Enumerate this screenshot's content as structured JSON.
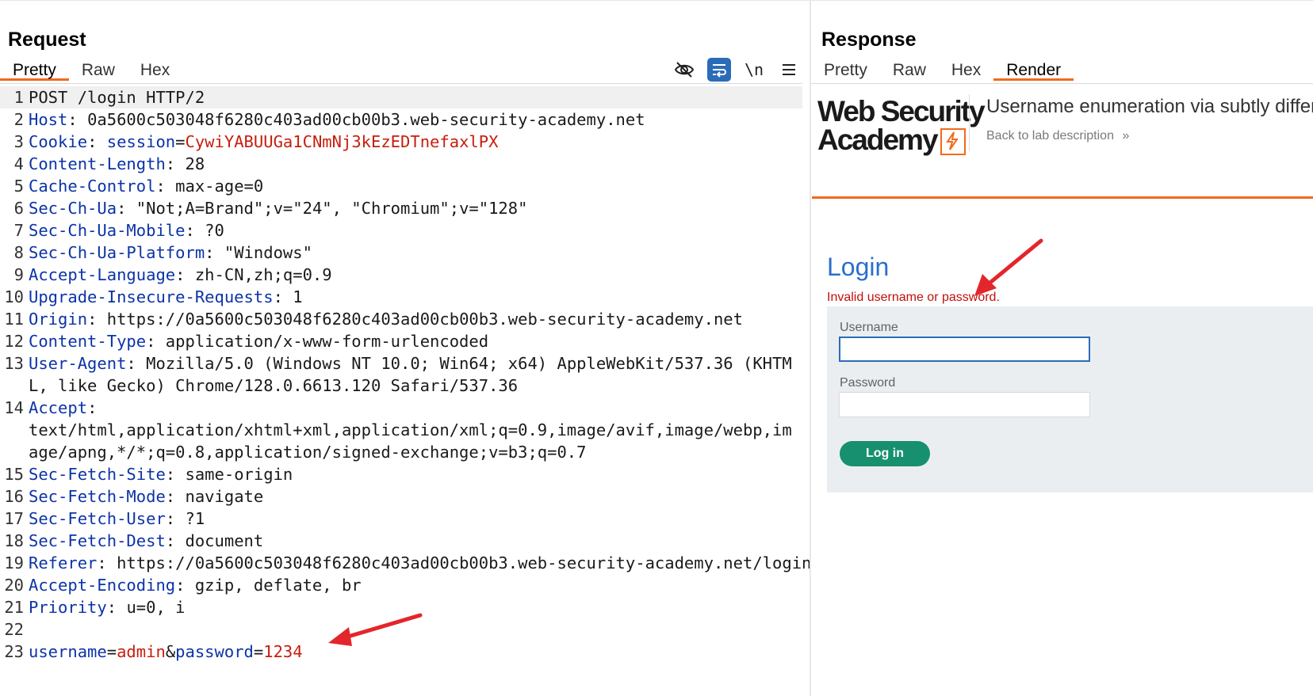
{
  "request": {
    "title": "Request",
    "tabs": [
      "Pretty",
      "Raw",
      "Hex"
    ],
    "active_tab": "Pretty",
    "toolbar": {
      "hide_icon": "eye-slash-icon",
      "wrap_icon": "text-wrap-icon",
      "newline_label": "\\n",
      "menu_icon": "hamburger-menu-icon"
    },
    "lines": [
      {
        "n": "1",
        "text": "POST /login HTTP/2"
      },
      {
        "n": "2",
        "key": "Host",
        "val": "0a5600c503048f6280c403ad00cb00b3.web-security-academy.net"
      },
      {
        "n": "3",
        "key": "Cookie",
        "sub": "session",
        "subval": "CywiYABUUGa1CNmNj3kEzEDTnefaxlPX"
      },
      {
        "n": "4",
        "key": "Content-Length",
        "val": "28"
      },
      {
        "n": "5",
        "key": "Cache-Control",
        "val": "max-age=0"
      },
      {
        "n": "6",
        "key": "Sec-Ch-Ua",
        "val": "\"Not;A=Brand\";v=\"24\", \"Chromium\";v=\"128\""
      },
      {
        "n": "7",
        "key": "Sec-Ch-Ua-Mobile",
        "val": "?0"
      },
      {
        "n": "8",
        "key": "Sec-Ch-Ua-Platform",
        "val": "\"Windows\""
      },
      {
        "n": "9",
        "key": "Accept-Language",
        "val": "zh-CN,zh;q=0.9"
      },
      {
        "n": "10",
        "key": "Upgrade-Insecure-Requests",
        "val": "1"
      },
      {
        "n": "11",
        "key": "Origin",
        "val": "https://0a5600c503048f6280c403ad00cb00b3.web-security-academy.net"
      },
      {
        "n": "12",
        "key": "Content-Type",
        "val": "application/x-www-form-urlencoded"
      },
      {
        "n": "13",
        "key": "User-Agent",
        "val": "Mozilla/5.0 (Windows NT 10.0; Win64; x64) AppleWebKit/537.36 (KHTML, like Gecko) Chrome/128.0.6613.120 Safari/537.36"
      },
      {
        "n": "14",
        "key": "Accept",
        "val": "text/html,application/xhtml+xml,application/xml;q=0.9,image/avif,image/webp,image/apng,*/*;q=0.8,application/signed-exchange;v=b3;q=0.7"
      },
      {
        "n": "15",
        "key": "Sec-Fetch-Site",
        "val": "same-origin"
      },
      {
        "n": "16",
        "key": "Sec-Fetch-Mode",
        "val": "navigate"
      },
      {
        "n": "17",
        "key": "Sec-Fetch-User",
        "val": "?1"
      },
      {
        "n": "18",
        "key": "Sec-Fetch-Dest",
        "val": "document"
      },
      {
        "n": "19",
        "key": "Referer",
        "val": "https://0a5600c503048f6280c403ad00cb00b3.web-security-academy.net/login"
      },
      {
        "n": "20",
        "key": "Accept-Encoding",
        "val": "gzip, deflate, br"
      },
      {
        "n": "21",
        "key": "Priority",
        "val": "u=0, i"
      },
      {
        "n": "22",
        "text": ""
      },
      {
        "n": "23",
        "body": [
          [
            "username",
            "admin"
          ],
          [
            "password",
            "1234"
          ]
        ]
      }
    ]
  },
  "response": {
    "title": "Response",
    "tabs": [
      "Pretty",
      "Raw",
      "Hex",
      "Render"
    ],
    "active_tab": "Render",
    "render": {
      "logo_line1": "Web Security",
      "logo_line2": "Academy",
      "lab_title": "Username enumeration via subtly different responses",
      "back_link": "Back to lab description",
      "back_icon": "double-chevron-right-icon",
      "login_heading": "Login",
      "error_message": "Invalid username or password.",
      "username_label": "Username",
      "username_value": "",
      "password_label": "Password",
      "password_value": "",
      "login_button": "Log in"
    }
  },
  "colors": {
    "accent_orange": "#f26a1b",
    "header_key_blue": "#0c33a8",
    "value_red": "#c81d0c",
    "login_button_green": "#16906f",
    "annotation_arrow_red": "#e3262b"
  }
}
